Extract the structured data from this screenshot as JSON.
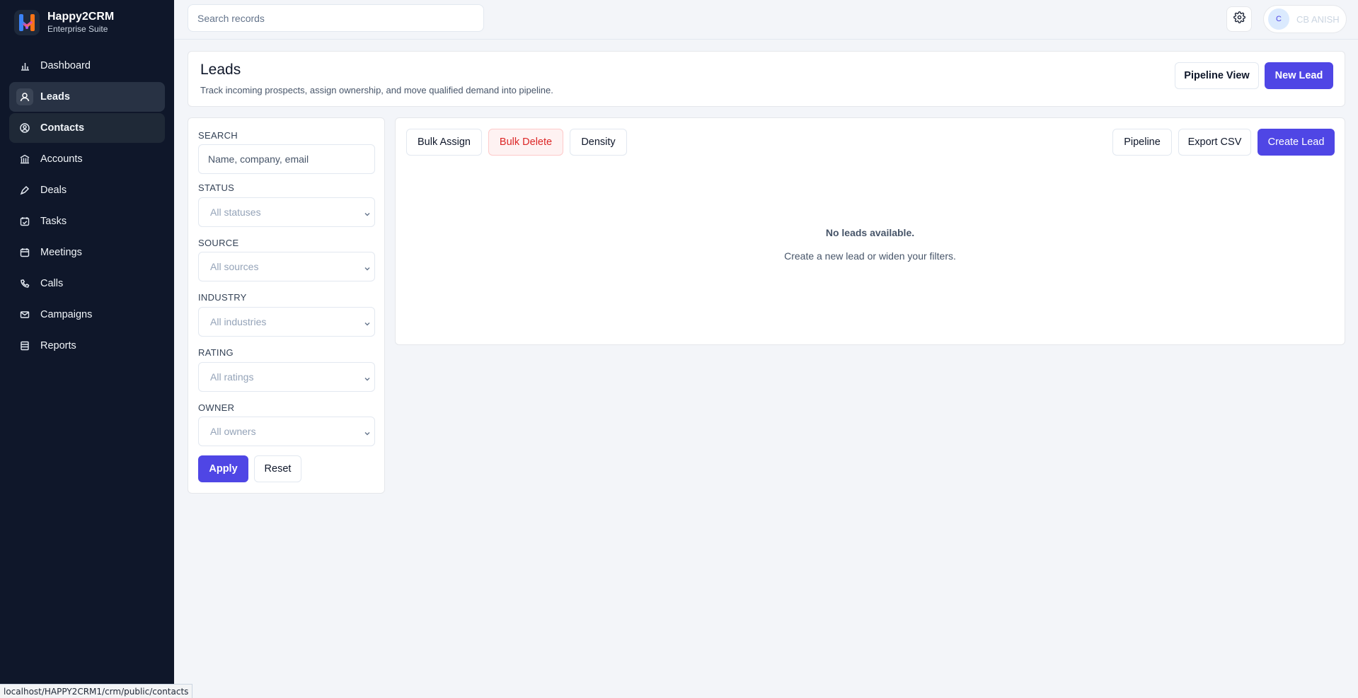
{
  "brand": {
    "name": "Happy2CRM",
    "subtitle": "Enterprise Suite"
  },
  "nav": {
    "items": [
      {
        "label": "Dashboard",
        "icon": "bar-chart-icon"
      },
      {
        "label": "Leads",
        "icon": "leads-icon",
        "state": "active"
      },
      {
        "label": "Contacts",
        "icon": "user-circle-icon",
        "state": "hover"
      },
      {
        "label": "Accounts",
        "icon": "bank-icon"
      },
      {
        "label": "Deals",
        "icon": "pen-icon"
      },
      {
        "label": "Tasks",
        "icon": "calendar-check-icon"
      },
      {
        "label": "Meetings",
        "icon": "calendar-icon"
      },
      {
        "label": "Calls",
        "icon": "phone-icon"
      },
      {
        "label": "Campaigns",
        "icon": "mail-icon"
      },
      {
        "label": "Reports",
        "icon": "report-icon"
      }
    ]
  },
  "topbar": {
    "search_placeholder": "Search records",
    "user_initial": "C",
    "user_name": "CB ANISH"
  },
  "header": {
    "title": "Leads",
    "subtitle": "Track incoming prospects, assign ownership, and move qualified demand into pipeline.",
    "pipeline_view_label": "Pipeline View",
    "new_lead_label": "New Lead"
  },
  "filters": {
    "search_label": "SEARCH",
    "search_placeholder": "Name, company, email",
    "status_label": "STATUS",
    "status_value": "All statuses",
    "source_label": "SOURCE",
    "source_value": "All sources",
    "industry_label": "INDUSTRY",
    "industry_value": "All industries",
    "rating_label": "RATING",
    "rating_value": "All ratings",
    "owner_label": "OWNER",
    "owner_value": "All owners",
    "apply_label": "Apply",
    "reset_label": "Reset"
  },
  "toolbar": {
    "bulk_assign_label": "Bulk Assign",
    "bulk_delete_label": "Bulk Delete",
    "density_label": "Density",
    "pipeline_label": "Pipeline",
    "export_csv_label": "Export CSV",
    "create_lead_label": "Create Lead"
  },
  "empty_state": {
    "title": "No leads available.",
    "subtitle": "Create a new lead or widen your filters."
  },
  "status_bar": {
    "url": "localhost/HAPPY2CRM1/crm/public/contacts"
  },
  "colors": {
    "sidebar": "#0f172a",
    "accent": "#4f46e5",
    "danger": "#dc2626"
  }
}
